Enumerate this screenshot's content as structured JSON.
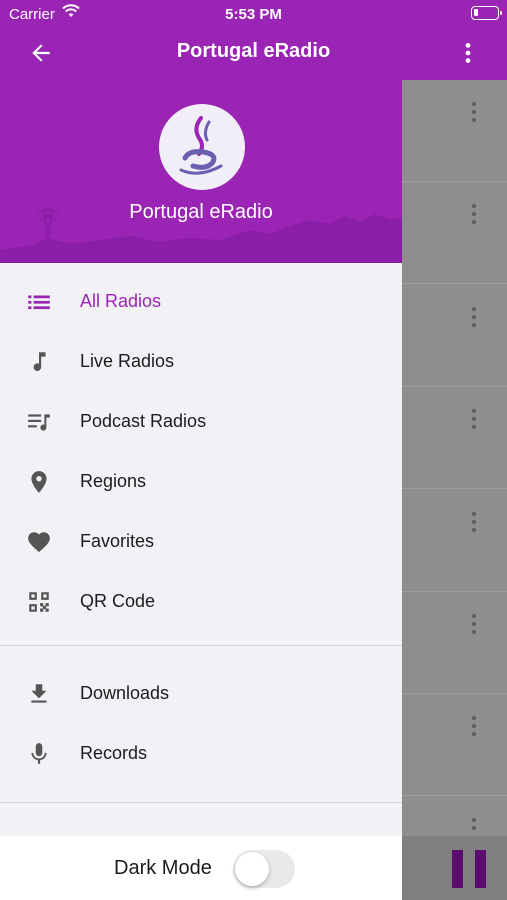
{
  "status_bar": {
    "carrier": "Carrier",
    "time": "5:53 PM"
  },
  "app_bar": {
    "title": "Portugal eRadio",
    "back_icon": "arrow-left-icon",
    "more_icon": "more-vertical-icon"
  },
  "drawer": {
    "header_title": "Portugal eRadio",
    "menu_primary": [
      {
        "label": "All Radios",
        "icon": "list-icon",
        "active": true
      },
      {
        "label": "Live Radios",
        "icon": "music-note-icon",
        "active": false
      },
      {
        "label": "Podcast Radios",
        "icon": "playlist-icon",
        "active": false
      },
      {
        "label": "Regions",
        "icon": "location-pin-icon",
        "active": false
      },
      {
        "label": "Favorites",
        "icon": "heart-icon",
        "active": false
      },
      {
        "label": "QR Code",
        "icon": "qr-code-icon",
        "active": false
      }
    ],
    "menu_secondary": [
      {
        "label": "Downloads",
        "icon": "download-icon"
      },
      {
        "label": "Records",
        "icon": "microphone-icon"
      }
    ],
    "dark_mode_label": "Dark Mode",
    "dark_mode_on": false
  },
  "colors": {
    "accent": "#9a24b4",
    "overlay": "#8e8e8e",
    "pause": "#5a0d6d"
  }
}
